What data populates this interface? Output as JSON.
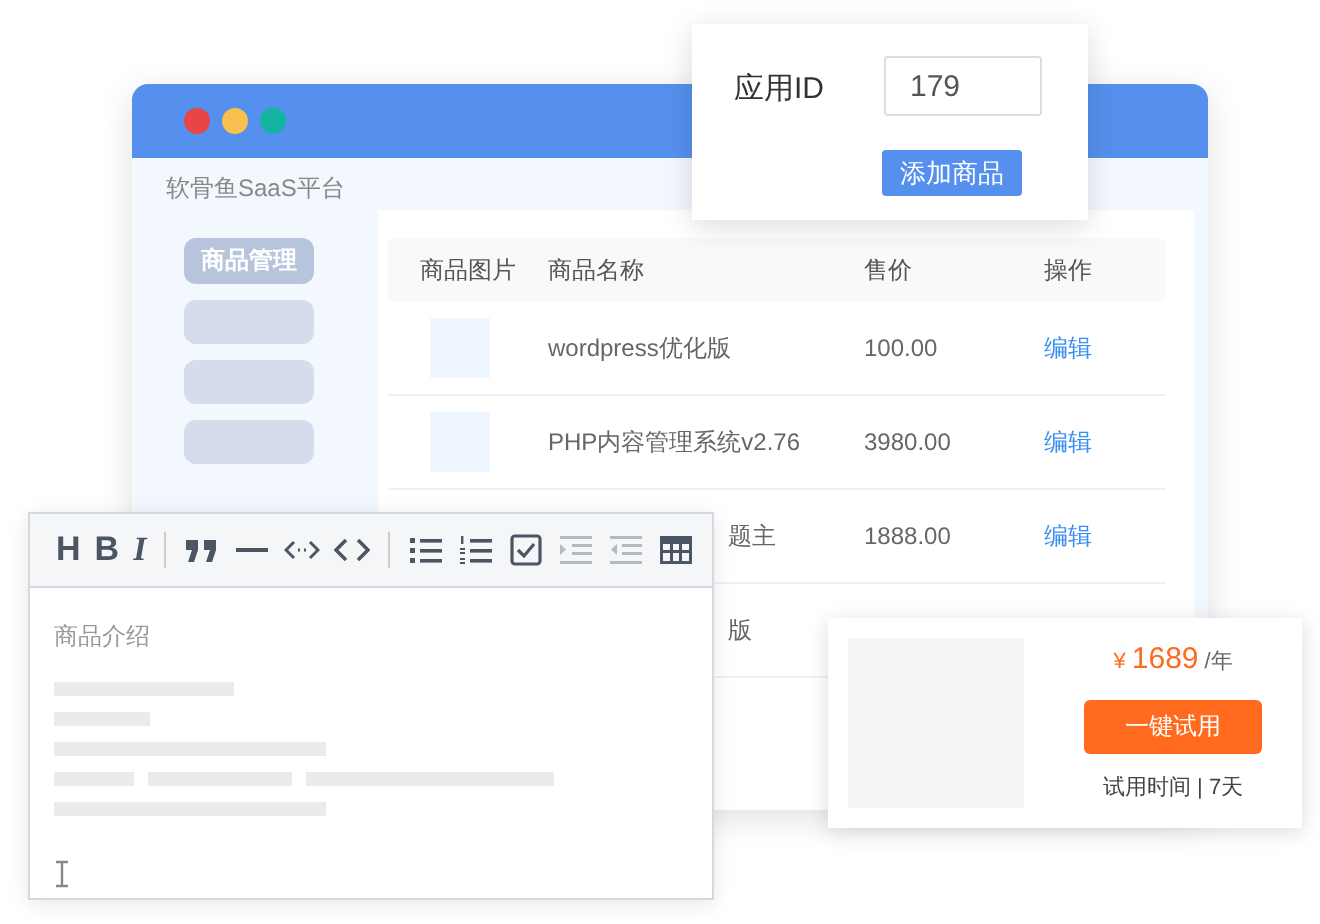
{
  "window": {
    "title": "软骨鱼SaaS平台"
  },
  "sidebar": {
    "items": [
      {
        "label": "商品管理",
        "selected": true
      },
      {
        "selected": false
      },
      {
        "selected": false
      },
      {
        "selected": false
      }
    ]
  },
  "table": {
    "columns": [
      "商品图片",
      "商品名称",
      "售价",
      "操作"
    ],
    "rows": [
      {
        "name": "wordpress优化版",
        "price": "100.00",
        "action": "编辑",
        "partial": false
      },
      {
        "name": "PHP内容管理系统v2.76",
        "price": "3980.00",
        "action": "编辑",
        "partial": false
      },
      {
        "name": "题主",
        "price": "1888.00",
        "action": "编辑",
        "partial": true
      },
      {
        "name": "版",
        "partial": true
      }
    ]
  },
  "popup": {
    "label": "应用ID",
    "value": "179",
    "button": "添加商品"
  },
  "editor": {
    "toolbar": [
      {
        "kind": "text",
        "label": "H",
        "italic": false,
        "disabled": false
      },
      {
        "kind": "text",
        "label": "B",
        "italic": false,
        "disabled": false
      },
      {
        "kind": "text",
        "label": "I",
        "italic": true,
        "disabled": false
      },
      {
        "kind": "sep"
      },
      {
        "kind": "quote",
        "disabled": false
      },
      {
        "kind": "hr",
        "disabled": false
      },
      {
        "kind": "inline-code",
        "disabled": false
      },
      {
        "kind": "code",
        "disabled": false
      },
      {
        "kind": "sep"
      },
      {
        "kind": "ul",
        "disabled": false
      },
      {
        "kind": "ol",
        "disabled": false
      },
      {
        "kind": "task",
        "disabled": false
      },
      {
        "kind": "indent",
        "disabled": true
      },
      {
        "kind": "outdent",
        "disabled": true
      },
      {
        "kind": "table",
        "disabled": false
      }
    ],
    "placeholder": "商品介绍"
  },
  "price_card": {
    "currency": "¥",
    "price": "1689",
    "unit": "/年",
    "button": "一键试用",
    "note": "试用时间 | 7天"
  }
}
